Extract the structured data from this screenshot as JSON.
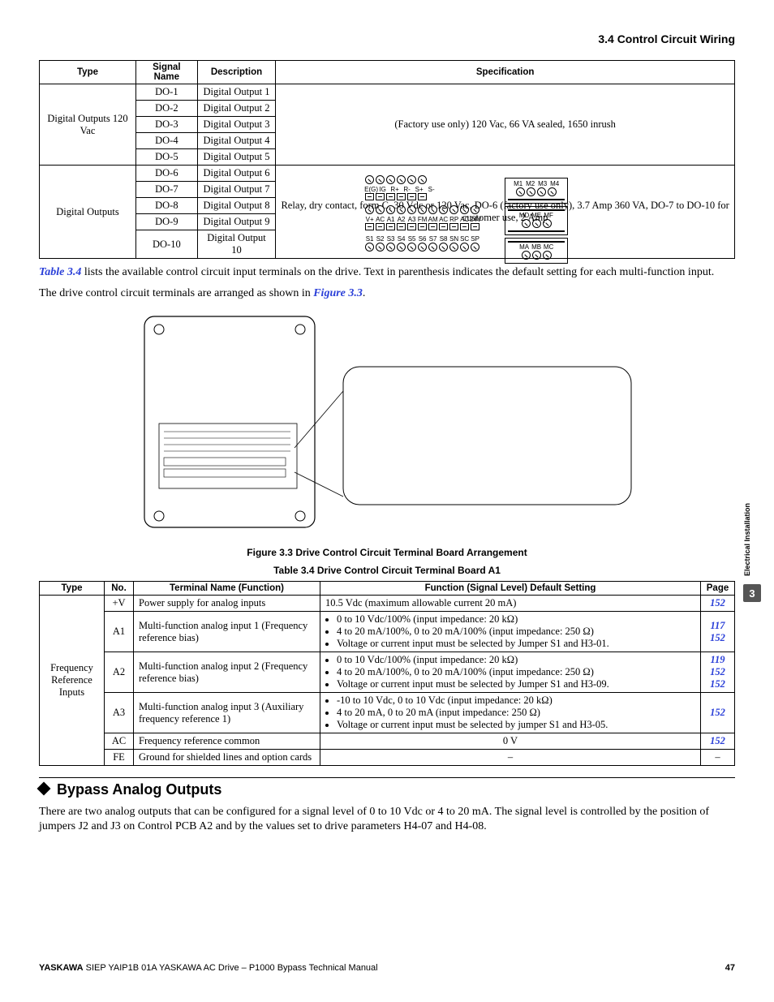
{
  "header": {
    "section_title": "3.4 Control Circuit Wiring"
  },
  "table1": {
    "headers": {
      "c1": "Type",
      "c2": "Signal Name",
      "c3": "Description",
      "c4": "Specification"
    },
    "group1": {
      "type": "Digital Outputs 120 Vac",
      "spec": "(Factory use only) 120 Vac, 66 VA sealed, 1650 inrush",
      "rows": [
        {
          "sig": "DO-1",
          "desc": "Digital Output 1"
        },
        {
          "sig": "DO-2",
          "desc": "Digital Output 2"
        },
        {
          "sig": "DO-3",
          "desc": "Digital Output 3"
        },
        {
          "sig": "DO-4",
          "desc": "Digital Output 4"
        },
        {
          "sig": "DO-5",
          "desc": "Digital Output 5"
        }
      ]
    },
    "group2": {
      "type": "Digital Outputs",
      "spec": "Relay, dry contact, form C, 30 Vdc or 120 Vac, DO-6 (factory use only), 3.7 Amp 360 VA, DO-7 to DO-10 for customer use, 2 Amp",
      "rows": [
        {
          "sig": "DO-6",
          "desc": "Digital Output 6"
        },
        {
          "sig": "DO-7",
          "desc": "Digital Output 7"
        },
        {
          "sig": "DO-8",
          "desc": "Digital Output 8"
        },
        {
          "sig": "DO-9",
          "desc": "Digital Output 9"
        },
        {
          "sig": "DO-10",
          "desc": "Digital Output 10"
        }
      ]
    }
  },
  "para1": {
    "link": "Table 3.4",
    "rest": " lists the available control circuit input terminals on the drive. Text in parenthesis indicates the default setting for each multi-function input."
  },
  "para2": {
    "pre": "The drive control circuit terminals are arranged as shown in ",
    "link": "Figure 3.3",
    "post": "."
  },
  "figure": {
    "caption": "Figure 3.3  Drive Control Circuit Terminal Board Arrangement",
    "row1_labels": [
      "E(G)",
      "IG",
      "R+",
      "R-",
      "S+",
      "S-"
    ],
    "row2_labels": [
      "V+",
      "AC",
      "A1",
      "A2",
      "A3",
      "FM",
      "AM",
      "AC",
      "RP",
      "AC",
      "24V"
    ],
    "row3_labels": [
      "S1",
      "S2",
      "S3",
      "S4",
      "S5",
      "S6",
      "S7",
      "S8",
      "SN",
      "SC",
      "SP"
    ],
    "relay1": [
      "M1",
      "M2",
      "M3",
      "M4"
    ],
    "relay2": [
      "MD",
      "ME",
      "MF"
    ],
    "relay3": [
      "MA",
      "MB",
      "MC"
    ]
  },
  "table2": {
    "caption": "Table 3.4  Drive Control Circuit Terminal Board A1",
    "headers": {
      "c1": "Type",
      "c2": "No.",
      "c3": "Terminal Name (Function)",
      "c4": "Function (Signal Level) Default Setting",
      "c5": "Page"
    },
    "type_label": "Frequency Reference Inputs",
    "rows": {
      "r1": {
        "no": "+V",
        "name": "Power supply for analog inputs",
        "func": "10.5 Vdc (maximum allowable current 20 mA)",
        "page": "152"
      },
      "r2": {
        "no": "A1",
        "name": "Multi-function analog input 1 (Frequency reference bias)",
        "b1": "0 to 10 Vdc/100% (input impedance: 20 kΩ)",
        "b2": "4 to 20 mA/100%, 0 to 20 mA/100% (input impedance: 250 Ω)",
        "b3": "Voltage or current input must be selected by Jumper S1 and H3-01.",
        "page1": "117",
        "page2": "152"
      },
      "r3": {
        "no": "A2",
        "name": "Multi-function analog input 2 (Frequency reference bias)",
        "b1": "0 to 10 Vdc/100% (input impedance: 20 kΩ)",
        "b2": "4 to 20 mA/100%, 0 to 20 mA/100% (input impedance: 250 Ω)",
        "b3": "Voltage or current input must be selected by Jumper S1 and H3-09.",
        "page1": "119",
        "page2": "152",
        "page3": "152"
      },
      "r4": {
        "no": "A3",
        "name": "Multi-function analog input 3 (Auxiliary frequency reference 1)",
        "b1": "-10 to 10 Vdc, 0 to 10 Vdc (input impedance: 20 kΩ)",
        "b2": "4 to 20 mA, 0 to 20 mA (input impedance: 250 Ω)",
        "b3": "Voltage or current input must be selected by jumper S1 and H3-05.",
        "page": "152"
      },
      "r5": {
        "no": "AC",
        "name": "Frequency reference common",
        "func": "0 V",
        "page": "152"
      },
      "r6": {
        "no": "FE",
        "name": "Ground for shielded lines and option cards",
        "func": "–",
        "page": "–"
      }
    }
  },
  "section": {
    "title": "Bypass Analog Outputs",
    "para": "There are two analog outputs that can be configured for a signal level of 0 to 10 Vdc or 4 to 20 mA. The signal level is controlled by the position of jumpers J2 and J3 on Control PCB A2 and by the values set to drive parameters H4-07 and H4-08."
  },
  "sidebar": {
    "label": "Electrical Installation",
    "num": "3"
  },
  "footer": {
    "brand": "YASKAWA",
    "rest": " SIEP YAIP1B 01A YASKAWA AC Drive – P1000 Bypass Technical Manual",
    "page": "47"
  }
}
